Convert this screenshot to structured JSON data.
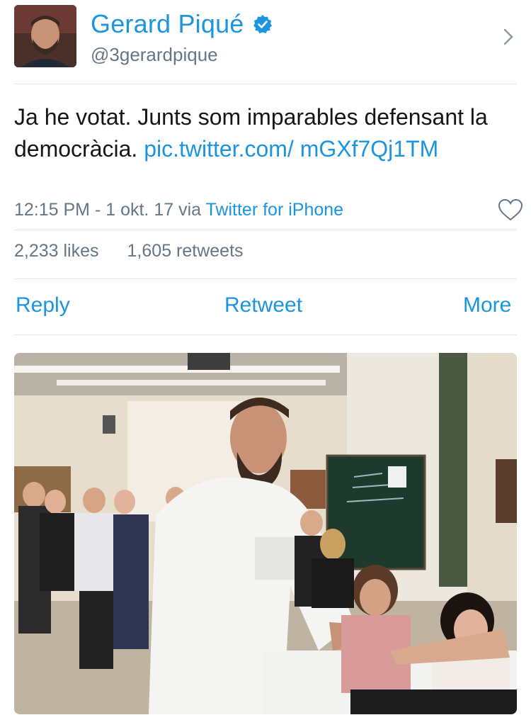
{
  "profile": {
    "name": "Gerard Piqué",
    "handle": "@3gerardpique",
    "verified": true,
    "icons": {
      "verified": "verified-badge-icon",
      "chevron": "chevron-right-icon"
    }
  },
  "tweet": {
    "text": "Ja he votat. Junts som imparables defensant la democràcia. ",
    "link": "pic.twitter.com/ mGXf7Qj1TM",
    "time": "12:15 PM - 1 okt. 17 via ",
    "source": "Twitter for iPhone"
  },
  "stats": {
    "likes": "2,233 likes",
    "retweets": "1,605 retweets"
  },
  "actions": {
    "reply": "Reply",
    "retweet": "Retweet",
    "more": "More"
  },
  "colors": {
    "link": "#1b95e0",
    "secondary_text": "#657786",
    "divider": "#e1e8ed"
  }
}
